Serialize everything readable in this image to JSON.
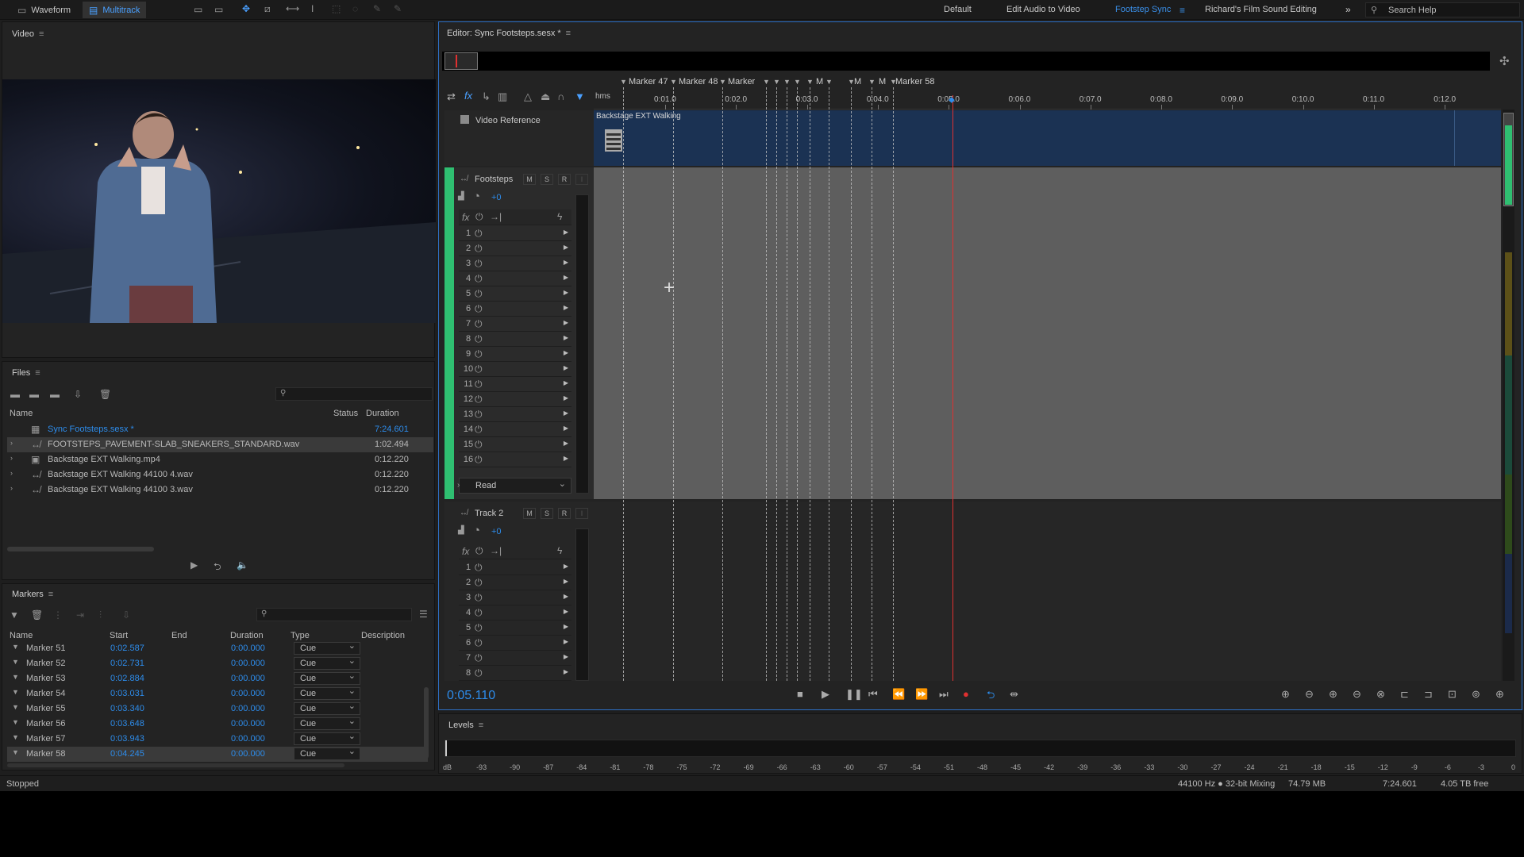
{
  "modes": {
    "waveform": "Waveform",
    "multitrack": "Multitrack"
  },
  "workspaces": [
    "Default",
    "Edit Audio to Video",
    "Footstep Sync",
    "Richard's Film Sound Editing"
  ],
  "search": {
    "placeholder": "Search Help"
  },
  "video_panel": {
    "title": "Video"
  },
  "files_panel": {
    "title": "Files",
    "columns": {
      "name": "Name",
      "status": "Status",
      "duration": "Duration"
    },
    "rows": [
      {
        "name": "Sync Footsteps.sesx *",
        "duration": "7:24.601"
      },
      {
        "name": "FOOTSTEPS_PAVEMENT-SLAB_SNEAKERS_STANDARD.wav",
        "duration": "1:02.494"
      },
      {
        "name": "Backstage EXT Walking.mp4",
        "duration": "0:12.220"
      },
      {
        "name": "Backstage EXT Walking 44100 4.wav",
        "duration": "0:12.220"
      },
      {
        "name": "Backstage EXT Walking 44100 3.wav",
        "duration": "0:12.220"
      }
    ]
  },
  "markers_panel": {
    "title": "Markers",
    "columns": {
      "name": "Name",
      "start": "Start",
      "end": "End",
      "duration": "Duration",
      "type": "Type",
      "description": "Description"
    },
    "rows": [
      {
        "name": "Marker 51",
        "start": "0:02.587",
        "duration": "0:00.000",
        "type": "Cue"
      },
      {
        "name": "Marker 52",
        "start": "0:02.731",
        "duration": "0:00.000",
        "type": "Cue"
      },
      {
        "name": "Marker 53",
        "start": "0:02.884",
        "duration": "0:00.000",
        "type": "Cue"
      },
      {
        "name": "Marker 54",
        "start": "0:03.031",
        "duration": "0:00.000",
        "type": "Cue"
      },
      {
        "name": "Marker 55",
        "start": "0:03.340",
        "duration": "0:00.000",
        "type": "Cue"
      },
      {
        "name": "Marker 56",
        "start": "0:03.648",
        "duration": "0:00.000",
        "type": "Cue"
      },
      {
        "name": "Marker 57",
        "start": "0:03.943",
        "duration": "0:00.000",
        "type": "Cue"
      },
      {
        "name": "Marker 58",
        "start": "0:04.245",
        "duration": "0:00.000",
        "type": "Cue"
      }
    ]
  },
  "editor": {
    "title": "Editor: Sync Footsteps.sesx *",
    "ruler_unit": "hms",
    "ruler_ticks": [
      "0:01.0",
      "0:02.0",
      "0:03.0",
      "0:04.0",
      "0:05.0",
      "0:06.0",
      "0:07.0",
      "0:08.0",
      "0:09.0",
      "0:10.0",
      "0:11.0",
      "0:12.0"
    ],
    "marker_labels": [
      "Marker 47",
      "Marker 48",
      "Marker",
      "M",
      "M",
      "M",
      "Marker 58"
    ],
    "video_track": {
      "name": "Video Reference",
      "clip": "Backstage EXT Walking"
    },
    "tracks": [
      {
        "name": "Footsteps",
        "volume": "+0",
        "slots": [
          "1",
          "2",
          "3",
          "4",
          "5",
          "6",
          "7",
          "8",
          "9",
          "10",
          "11",
          "12",
          "13",
          "14",
          "15",
          "16"
        ],
        "automation": "Read"
      },
      {
        "name": "Track 2",
        "volume": "+0",
        "slots": [
          "1",
          "2",
          "3",
          "4",
          "5",
          "6",
          "7",
          "8"
        ]
      }
    ],
    "btn_m": "M",
    "btn_s": "S",
    "btn_r": "R",
    "time": "0:05.110"
  },
  "levels_panel": {
    "title": "Levels",
    "scale": [
      "dB",
      "-93",
      "-90",
      "-87",
      "-84",
      "-81",
      "-78",
      "-75",
      "-72",
      "-69",
      "-66",
      "-63",
      "-60",
      "-57",
      "-54",
      "-51",
      "-48",
      "-45",
      "-42",
      "-39",
      "-36",
      "-33",
      "-30",
      "-27",
      "-24",
      "-21",
      "-18",
      "-15",
      "-12",
      "-9",
      "-6",
      "-3",
      "0"
    ]
  },
  "status": {
    "state": "Stopped",
    "format": "44100 Hz ● 32-bit Mixing",
    "size": "74.79 MB",
    "duration": "7:24.601",
    "free": "4.05 TB free"
  },
  "colors": {
    "accent": "#2d8ceb",
    "playhead": "#e03030",
    "footsteps_track": "#2fbf71"
  }
}
